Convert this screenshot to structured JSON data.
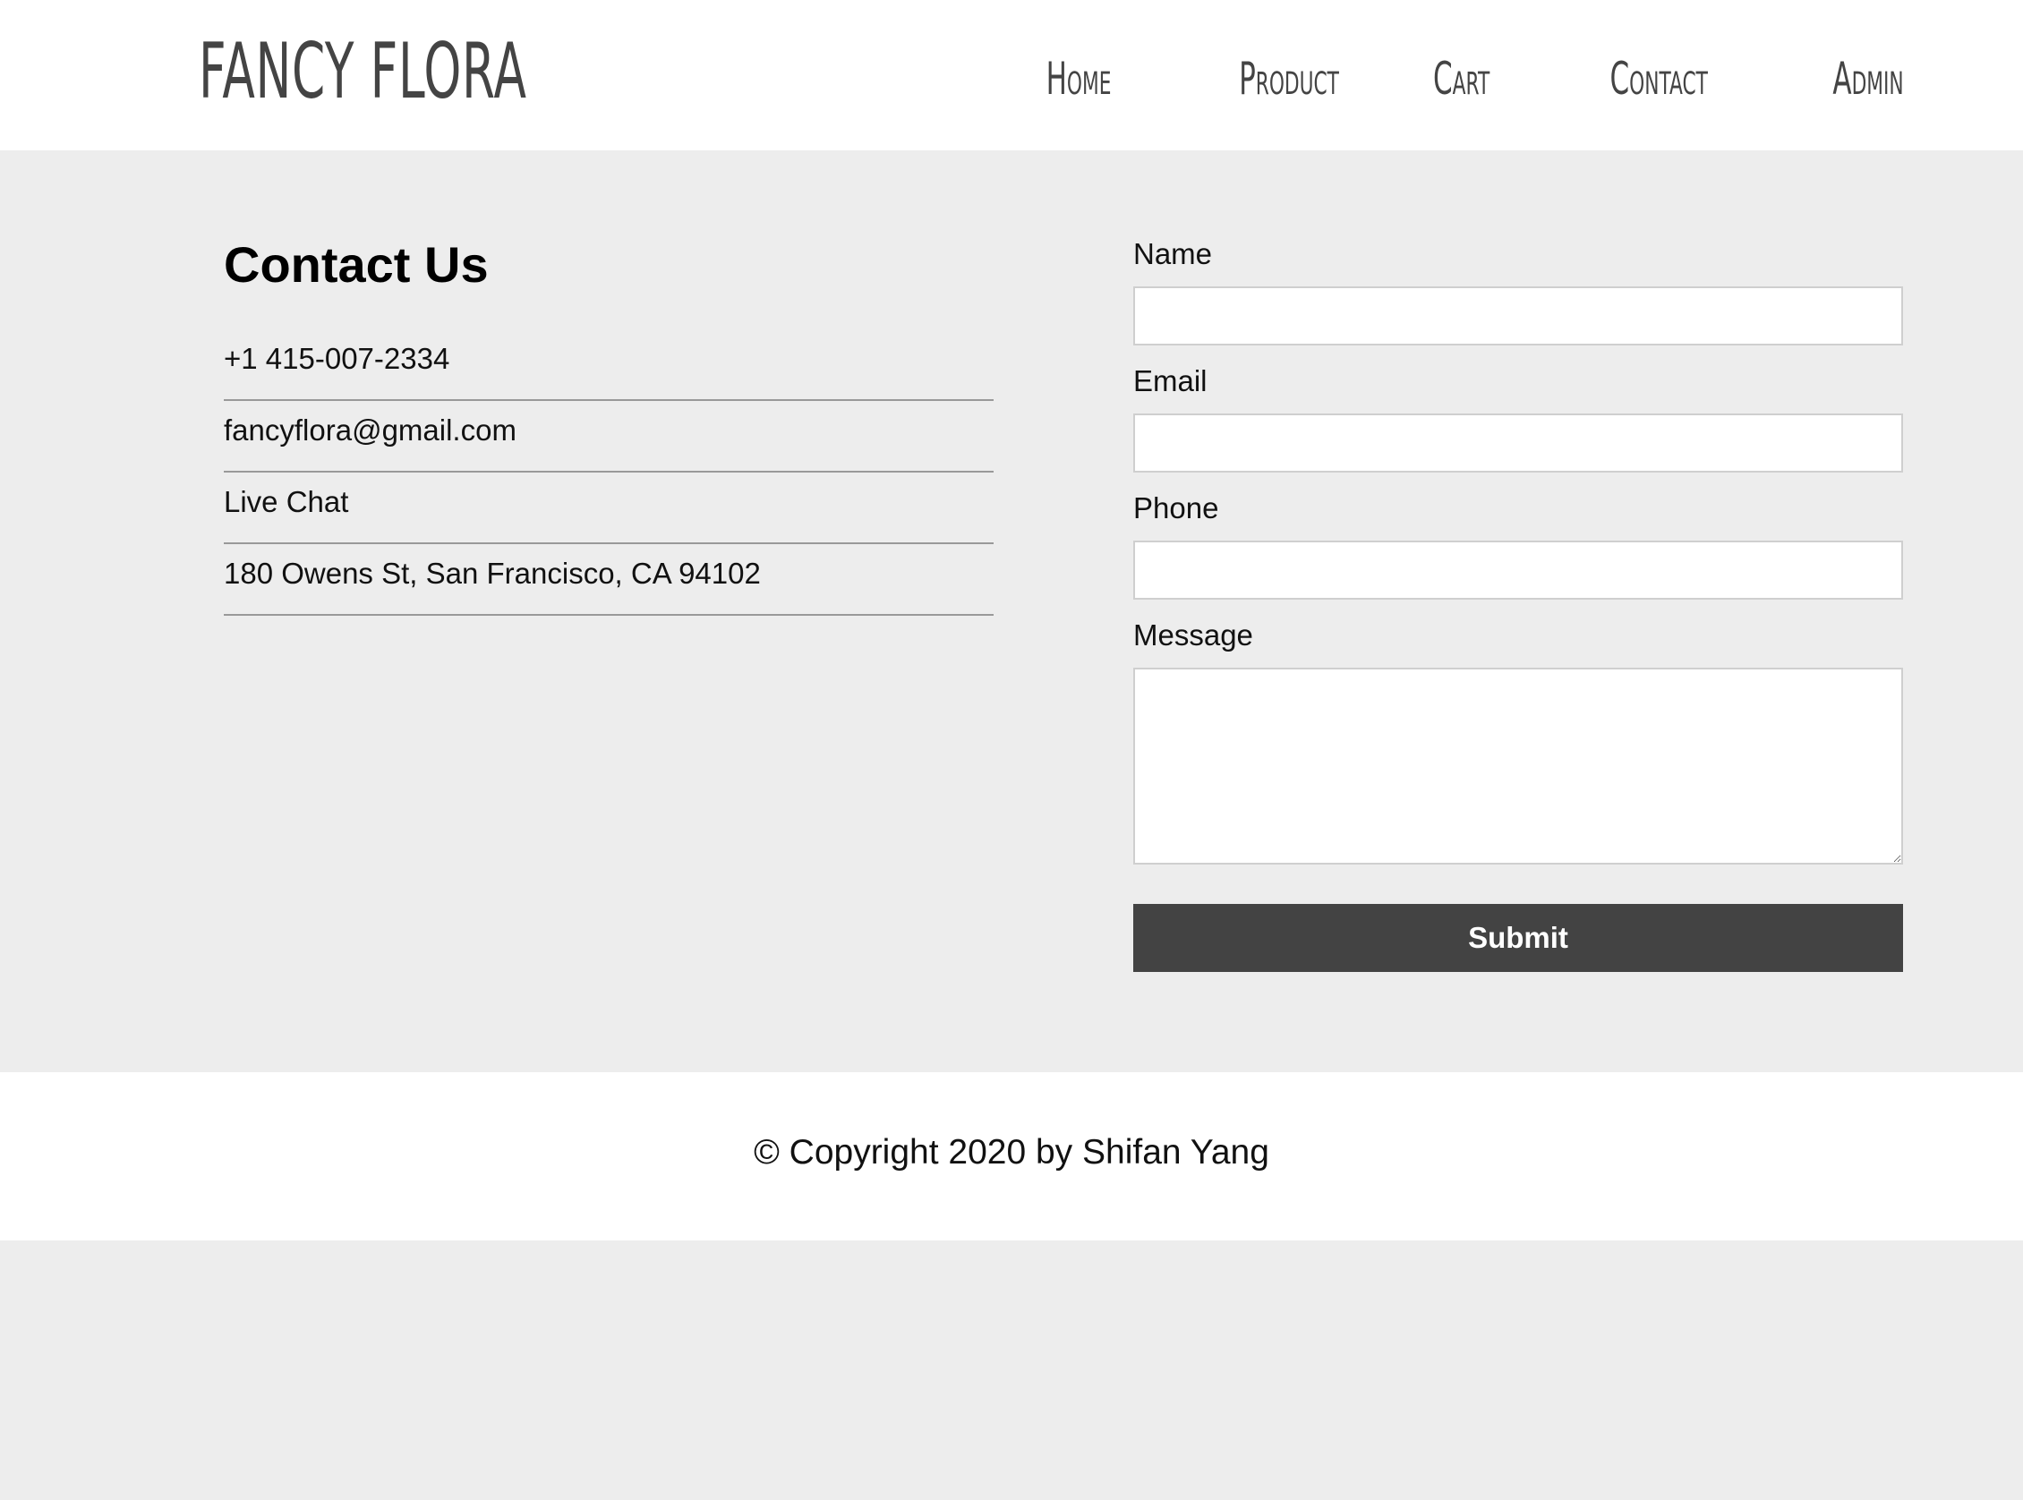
{
  "header": {
    "logo": "FANCY FLORA",
    "nav": [
      {
        "label": "Home"
      },
      {
        "label": "Product"
      },
      {
        "label": "Cart"
      },
      {
        "label": "Contact"
      },
      {
        "label": "Admin"
      }
    ]
  },
  "contact": {
    "title": "Contact Us",
    "items": [
      "+1 415-007-2334",
      "fancyflora@gmail.com",
      "Live Chat",
      "180 Owens St, San Francisco, CA 94102"
    ]
  },
  "form": {
    "name_label": "Name",
    "name_value": "",
    "email_label": "Email",
    "email_value": "",
    "phone_label": "Phone",
    "phone_value": "",
    "message_label": "Message",
    "message_value": "",
    "submit_label": "Submit"
  },
  "footer": {
    "copyright": "© Copyright 2020 by Shifan Yang"
  },
  "colors": {
    "background": "#ededed",
    "header_bg": "#ffffff",
    "text_dark": "#444444",
    "button_bg": "#434343",
    "button_text": "#ffffff",
    "divider": "#999999"
  }
}
